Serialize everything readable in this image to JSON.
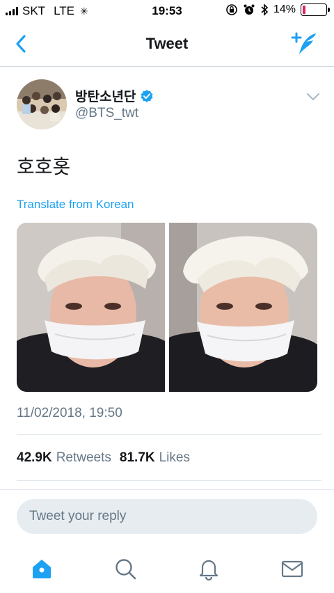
{
  "status_bar": {
    "carrier": "SKT",
    "network": "LTE",
    "time": "19:53",
    "battery_percent": "14%",
    "battery_level": 0.14
  },
  "nav": {
    "title": "Tweet"
  },
  "tweet": {
    "display_name": "방탄소년단",
    "handle": "@BTS_twt",
    "text": "호호홋",
    "translate_label": "Translate from Korean",
    "timestamp": "11/02/2018, 19:50",
    "retweets_count": "42.9K",
    "retweets_label": "Retweets",
    "likes_count": "81.7K",
    "likes_label": "Likes"
  },
  "reply": {
    "placeholder": "Tweet your reply"
  },
  "colors": {
    "accent": "#1da1f2",
    "secondary_text": "#657786",
    "battery_low": "#e0245e"
  },
  "icons": {
    "back": "chevron-left-icon",
    "compose": "compose-tweet-icon",
    "verified": "verified-badge-icon",
    "more": "chevron-down-icon",
    "tabs": [
      "home-icon",
      "search-icon",
      "notifications-icon",
      "messages-icon"
    ]
  }
}
